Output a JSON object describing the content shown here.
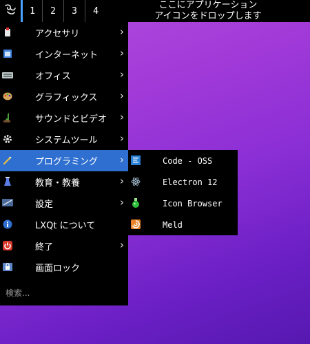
{
  "panel": {
    "desktops": [
      "1",
      "2",
      "3",
      "4"
    ],
    "active_desktop": "1",
    "task_line1": "ここにアプリケーション",
    "task_line2": "アイコンをドロップします"
  },
  "menu": {
    "items": [
      {
        "label": "アクセサリ",
        "icon": "accessories-icon",
        "submenu": true
      },
      {
        "label": "インターネット",
        "icon": "internet-icon",
        "submenu": true
      },
      {
        "label": "オフィス",
        "icon": "office-icon",
        "submenu": true
      },
      {
        "label": "グラフィックス",
        "icon": "graphics-icon",
        "submenu": true
      },
      {
        "label": "サウンドとビデオ",
        "icon": "sound-video-icon",
        "submenu": true
      },
      {
        "label": "システムツール",
        "icon": "system-tools-icon",
        "submenu": true
      },
      {
        "label": "プログラミング",
        "icon": "programming-icon",
        "submenu": true,
        "highlighted": true
      },
      {
        "label": "教育・教養",
        "icon": "education-icon",
        "submenu": true
      },
      {
        "label": "設定",
        "icon": "settings-icon",
        "submenu": true
      },
      {
        "label": "LXQt について",
        "icon": "about-icon",
        "submenu": false
      },
      {
        "label": "終了",
        "icon": "leave-icon",
        "submenu": true
      },
      {
        "label": "画面ロック",
        "icon": "lock-screen-icon",
        "submenu": false
      }
    ],
    "search_placeholder": "検索..."
  },
  "submenu": {
    "items": [
      {
        "label": "Code - OSS",
        "icon": "code-oss-icon"
      },
      {
        "label": "Electron 12",
        "icon": "electron-icon"
      },
      {
        "label": "Icon Browser",
        "icon": "icon-browser-icon"
      },
      {
        "label": "Meld",
        "icon": "meld-icon"
      }
    ]
  },
  "colors": {
    "panel_bg": "#000000",
    "highlight": "#2f6fd0",
    "desktop_active_marker": "#4aa3ff"
  }
}
